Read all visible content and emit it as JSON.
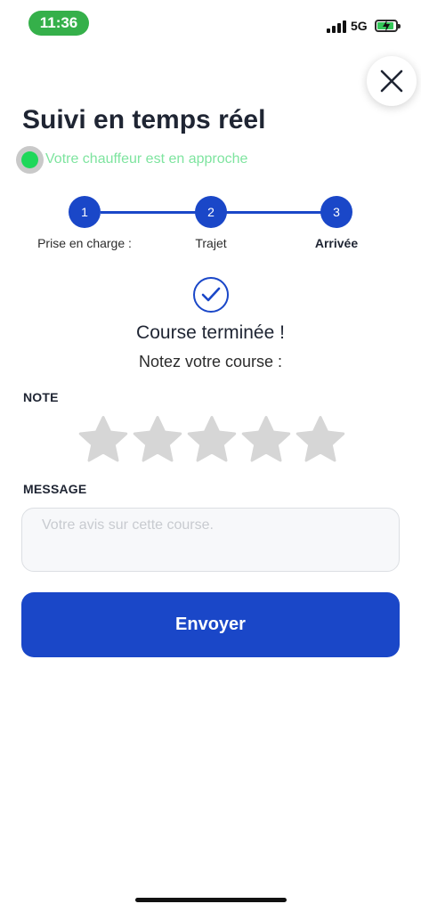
{
  "status_bar": {
    "time": "11:36",
    "network": "5G"
  },
  "header": {
    "title": "Suivi en temps réel",
    "status_text": "Votre chauffeur est en approche"
  },
  "stepper": {
    "steps": [
      {
        "number": "1",
        "label": "Prise en charge :"
      },
      {
        "number": "2",
        "label": "Trajet"
      },
      {
        "number": "3",
        "label": "Arrivée"
      }
    ],
    "active_index": 3
  },
  "completion": {
    "title": "Course terminée !",
    "prompt": "Notez votre course :"
  },
  "rating": {
    "label": "NOTE",
    "value": 0,
    "max": 5
  },
  "message": {
    "label": "MESSAGE",
    "value": "",
    "placeholder": "Votre avis sur cette course."
  },
  "submit": {
    "label": "Envoyer"
  },
  "colors": {
    "primary": "#1a47c8",
    "status_green": "#1fd85a",
    "star_inactive": "#d6d6d6"
  },
  "icons": {
    "close": "close-icon",
    "check": "check-circle-icon",
    "star": "star-icon"
  }
}
